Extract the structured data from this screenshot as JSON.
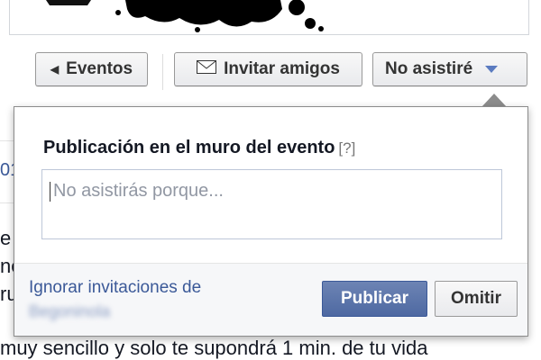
{
  "toolbar": {
    "back_label": "Eventos",
    "invite_label": "Invitar amigos",
    "rsvp_label": "No asistiré"
  },
  "popup": {
    "title": "Publicación en el muro del evento",
    "help": "[?]",
    "placeholder": "No asistirás porque...",
    "ignore_text": "Ignorar invitaciones de",
    "ignore_name": "Begoninola",
    "publish_label": "Publicar",
    "omit_label": "Omitir"
  },
  "background": {
    "left_fragments": [
      "01",
      "e",
      "ne",
      "ru"
    ],
    "bottom_line": "muy sencillo y solo te supondrá 1 min. de tu vida"
  },
  "icons": {
    "back": "caret-left-icon",
    "invite": "envelope-icon",
    "dropdown": "caret-down-icon"
  },
  "colors": {
    "link": "#3b5998",
    "primary": "#4e69a2",
    "dropdown_arrow": "#5b7bc0"
  }
}
